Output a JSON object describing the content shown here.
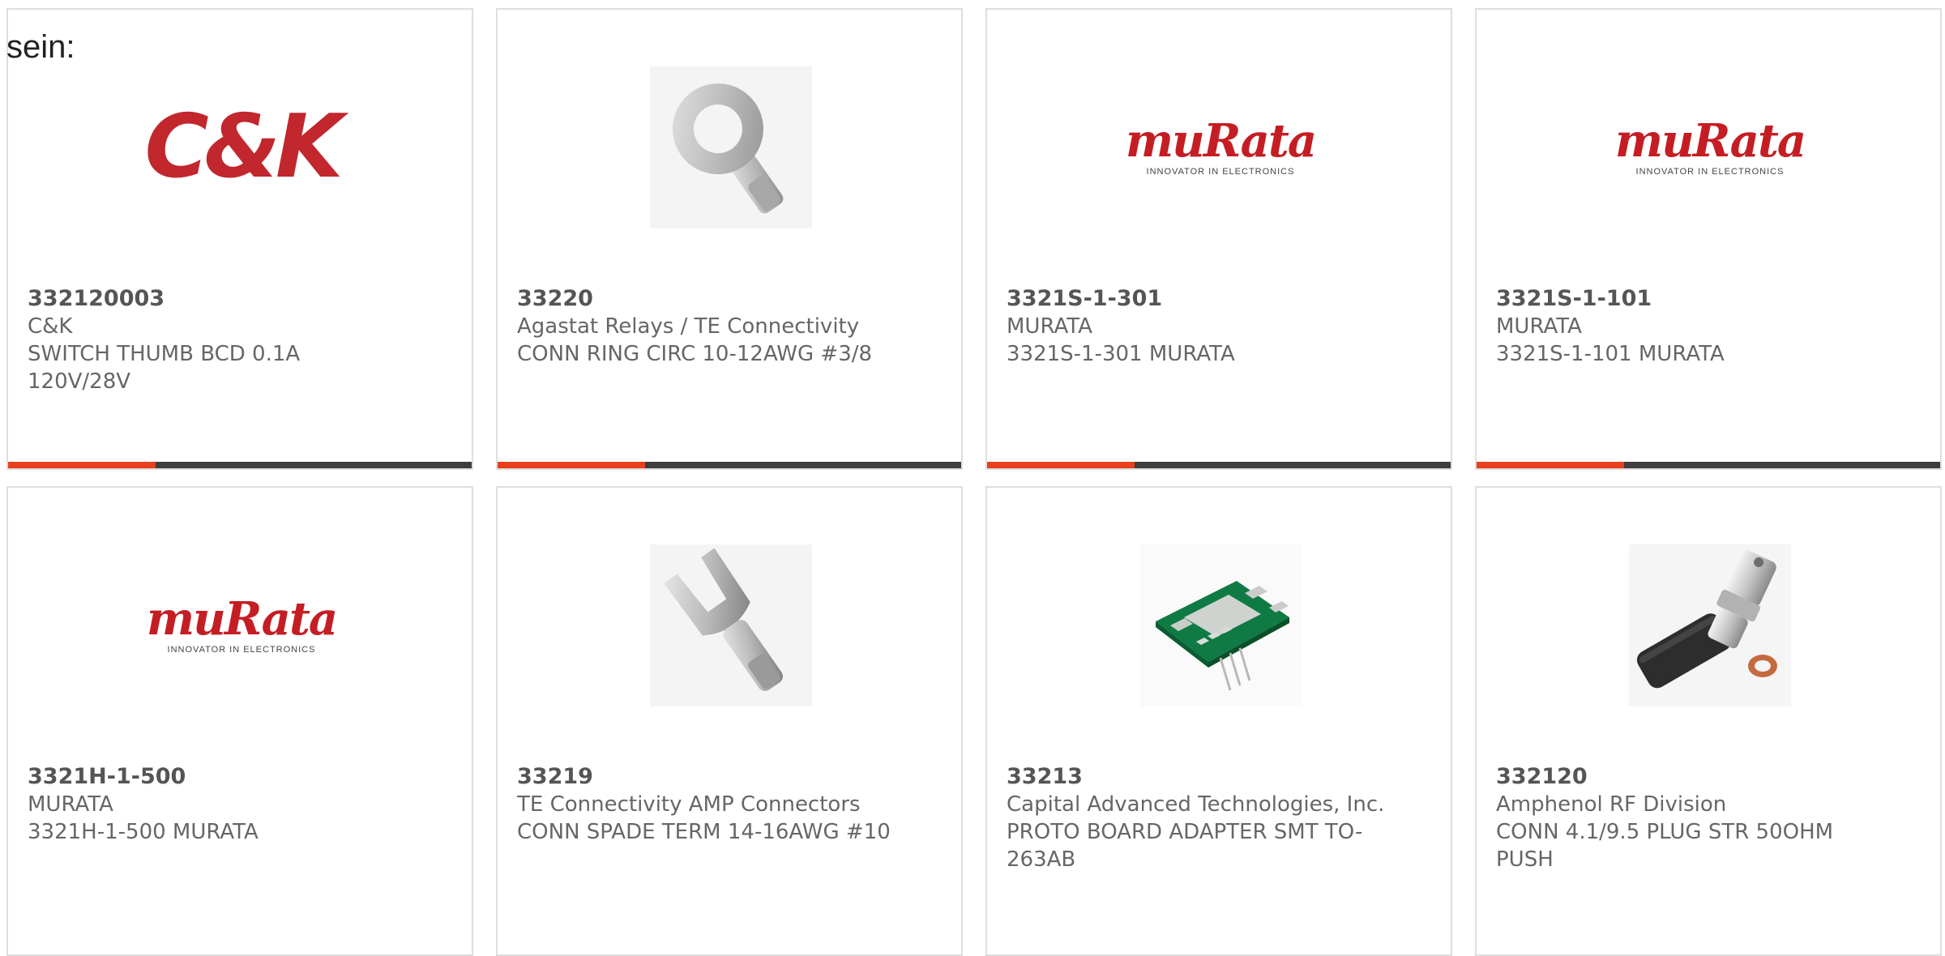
{
  "lead_text": "sein:",
  "colors": {
    "accent": "#e8401c",
    "bar": "#3d3d3d",
    "brand_red": "#c1272d"
  },
  "products": [
    {
      "part_number": "332120003",
      "manufacturer": "C&K",
      "description": "SWITCH THUMB BCD 0.1A 120V/28V",
      "image": "ck-logo",
      "logo_text": "C&K"
    },
    {
      "part_number": "33220",
      "manufacturer": "Agastat Relays / TE Connectivity",
      "description": "CONN RING CIRC 10-12AWG #3/8",
      "image": "ring-terminal-photo"
    },
    {
      "part_number": "3321S-1-301",
      "manufacturer": "MURATA",
      "description": "3321S-1-301 MURATA",
      "image": "murata-logo",
      "logo_text": "muRata",
      "logo_tagline": "INNOVATOR IN ELECTRONICS"
    },
    {
      "part_number": "3321S-1-101",
      "manufacturer": "MURATA",
      "description": "3321S-1-101 MURATA",
      "image": "murata-logo",
      "logo_text": "muRata",
      "logo_tagline": "INNOVATOR IN ELECTRONICS"
    },
    {
      "part_number": "3321H-1-500",
      "manufacturer": "MURATA",
      "description": "3321H-1-500 MURATA",
      "image": "murata-logo",
      "logo_text": "muRata",
      "logo_tagline": "INNOVATOR IN ELECTRONICS"
    },
    {
      "part_number": "33219",
      "manufacturer": "TE Connectivity AMP Connectors",
      "description": "CONN SPADE TERM 14-16AWG #10",
      "image": "spade-terminal-photo"
    },
    {
      "part_number": "33213",
      "manufacturer": "Capital Advanced Technologies, Inc.",
      "description": "PROTO BOARD ADAPTER SMT TO-263AB",
      "image": "pcb-adapter-photo"
    },
    {
      "part_number": "332120",
      "manufacturer": "Amphenol RF Division",
      "description": "CONN 4.1/9.5 PLUG STR 50OHM PUSH",
      "image": "rf-connector-photo"
    }
  ]
}
